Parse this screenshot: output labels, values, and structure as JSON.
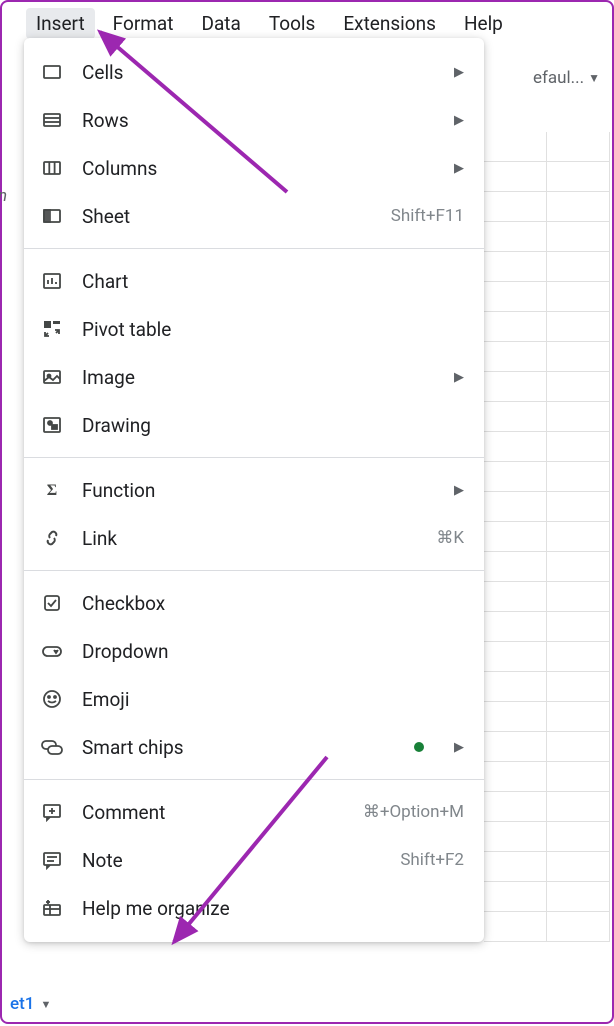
{
  "menubar": {
    "items": [
      "Insert",
      "Format",
      "Data",
      "Tools",
      "Extensions",
      "Help"
    ],
    "active_index": 0
  },
  "toolbar": {
    "font_truncated": "efaul..."
  },
  "left_label": "n",
  "sheet_tab": "et1",
  "dropdown": {
    "groups": [
      [
        {
          "icon": "cells-icon",
          "label": "Cells",
          "has_submenu": true
        },
        {
          "icon": "rows-icon",
          "label": "Rows",
          "has_submenu": true
        },
        {
          "icon": "columns-icon",
          "label": "Columns",
          "has_submenu": true
        },
        {
          "icon": "sheet-icon",
          "label": "Sheet",
          "shortcut": "Shift+F11"
        }
      ],
      [
        {
          "icon": "chart-icon",
          "label": "Chart"
        },
        {
          "icon": "pivot-icon",
          "label": "Pivot table"
        },
        {
          "icon": "image-icon",
          "label": "Image",
          "has_submenu": true
        },
        {
          "icon": "drawing-icon",
          "label": "Drawing"
        }
      ],
      [
        {
          "icon": "function-icon",
          "label": "Function",
          "has_submenu": true
        },
        {
          "icon": "link-icon",
          "label": "Link",
          "shortcut": "⌘K"
        }
      ],
      [
        {
          "icon": "checkbox-icon",
          "label": "Checkbox"
        },
        {
          "icon": "dropdown-icon",
          "label": "Dropdown"
        },
        {
          "icon": "emoji-icon",
          "label": "Emoji"
        },
        {
          "icon": "smartchips-icon",
          "label": "Smart chips",
          "has_submenu": true,
          "badge": true
        }
      ],
      [
        {
          "icon": "comment-icon",
          "label": "Comment",
          "shortcut": "⌘+Option+M"
        },
        {
          "icon": "note-icon",
          "label": "Note",
          "shortcut": "Shift+F2"
        },
        {
          "icon": "organize-icon",
          "label": "Help me organize"
        }
      ]
    ]
  },
  "colors": {
    "annotation": "#9c27b0",
    "badge": "#188038",
    "link": "#1a73e8"
  }
}
